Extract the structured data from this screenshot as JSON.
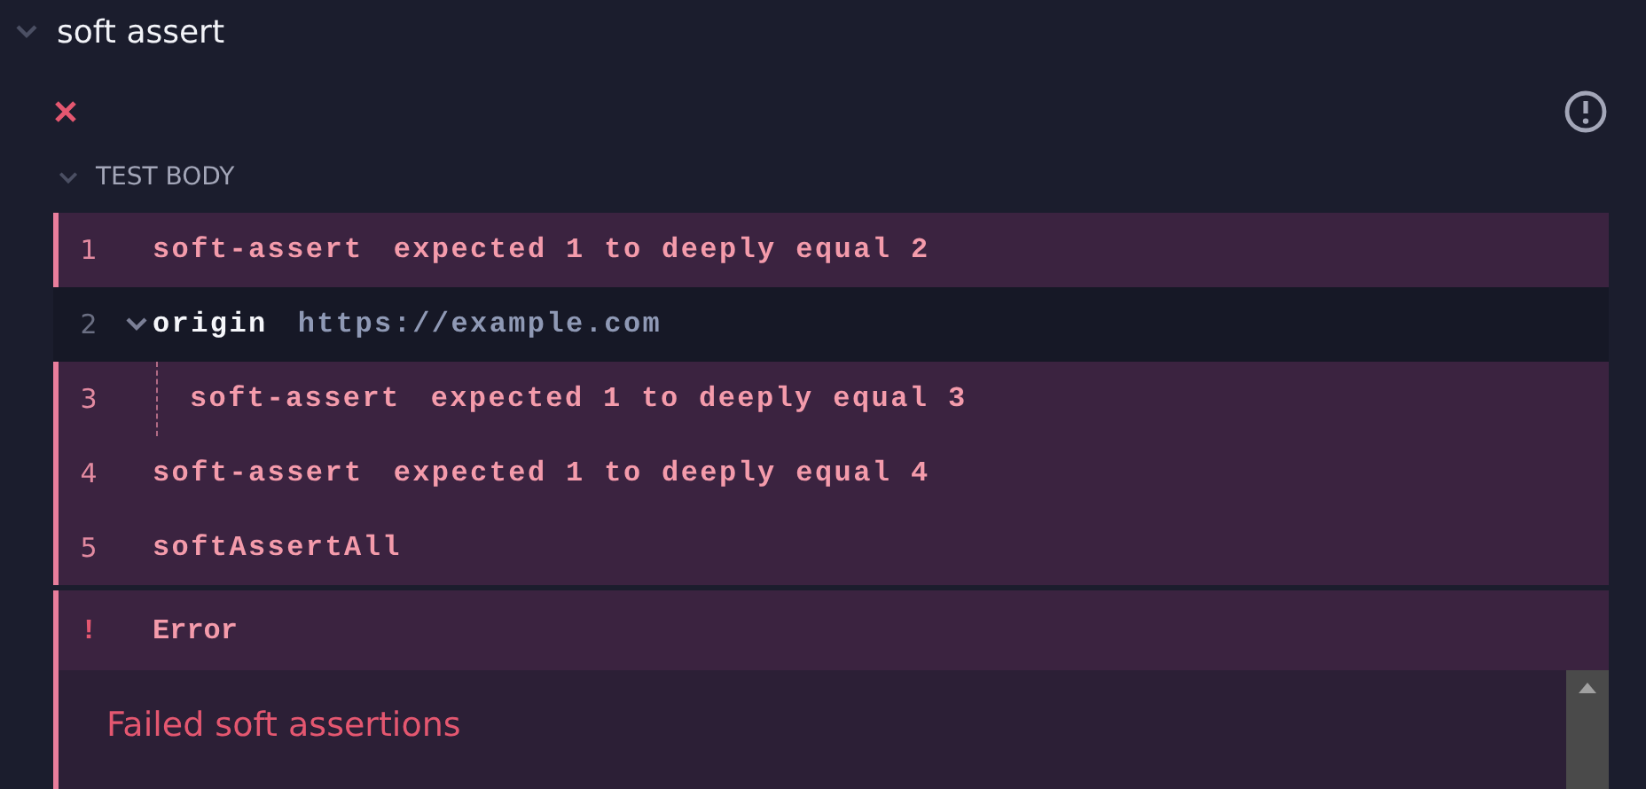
{
  "test": {
    "title": "soft assert",
    "expanded": true,
    "failed": true
  },
  "section": {
    "label": "TEST BODY",
    "expanded": true
  },
  "commands": [
    {
      "number": "1",
      "name": "soft-assert",
      "message": "expected 1 to deeply equal 2",
      "failed": true
    },
    {
      "number": "2",
      "name": "origin",
      "message": "https://example.com",
      "failed": false,
      "expanded": true,
      "children": [
        {
          "number": "3",
          "name": "soft-assert",
          "message": "expected 1 to deeply equal 3",
          "failed": true
        }
      ]
    },
    {
      "number": "4",
      "name": "soft-assert",
      "message": "expected 1 to deeply equal 4",
      "failed": true
    },
    {
      "number": "5",
      "name": "softAssertAll",
      "failed": true
    }
  ],
  "error": {
    "marker": "!",
    "label": "Error",
    "message": "Failed soft assertions"
  }
}
